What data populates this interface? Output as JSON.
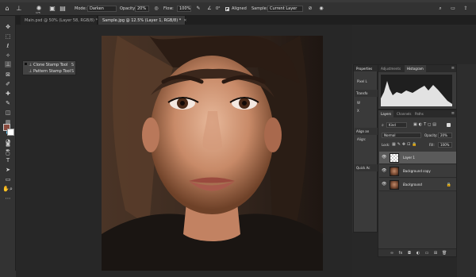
{
  "optionsbar": {
    "mode_label": "Mode:",
    "mode_value": "Darken",
    "opacity_label": "Opacity:",
    "opacity_value": "20%",
    "flow_label": "Flow:",
    "flow_value": "100%",
    "angle_value": "0°",
    "aligned_label": "Aligned",
    "sample_label": "Sample:",
    "sample_value": "Current Layer",
    "brush_size": "175"
  },
  "tabs": [
    {
      "label": "Main.psd @ 50% (Layer 58, RGB/8) *",
      "active": false
    },
    {
      "label": "Sample.jpg @ 12.5% (Layer 1, RGB/8) *",
      "active": true
    }
  ],
  "flyout": {
    "items": [
      {
        "label": "Clone Stamp Tool",
        "key": "S"
      },
      {
        "label": "Pattern Stamp Tool",
        "key": "S"
      }
    ]
  },
  "properties": {
    "title": "Properties",
    "pixel_label": "Pixel L",
    "transform": "Transfo",
    "w_label": "W",
    "x_label": "X",
    "align": "Align an",
    "align2": "Align:",
    "quick": "Quick Ac"
  },
  "histogram_panel": {
    "tabs": [
      "Adjustments",
      "Histogram"
    ],
    "active_tab": "Histogram"
  },
  "layers_panel": {
    "tabs": [
      "Layers",
      "Channels",
      "Paths"
    ],
    "active_tab": "Layers",
    "kind_label": "Kind",
    "blend_mode": "Normal",
    "opacity_label": "Opacity:",
    "opacity_value": "20%",
    "lock_label": "Lock:",
    "fill_label": "Fill:",
    "fill_value": "100%",
    "layers": [
      {
        "name": "Layer 1",
        "thumb": "transparent",
        "selected": true,
        "locked": false
      },
      {
        "name": "Background copy",
        "thumb": "face",
        "selected": false,
        "locked": false
      },
      {
        "name": "Background",
        "thumb": "face",
        "selected": false,
        "locked": true
      }
    ]
  },
  "colors": {
    "foreground": "#8a4a3e",
    "background": "#ffffff",
    "panel_bg": "#383838",
    "selected_layer": "#5a5a5a"
  }
}
